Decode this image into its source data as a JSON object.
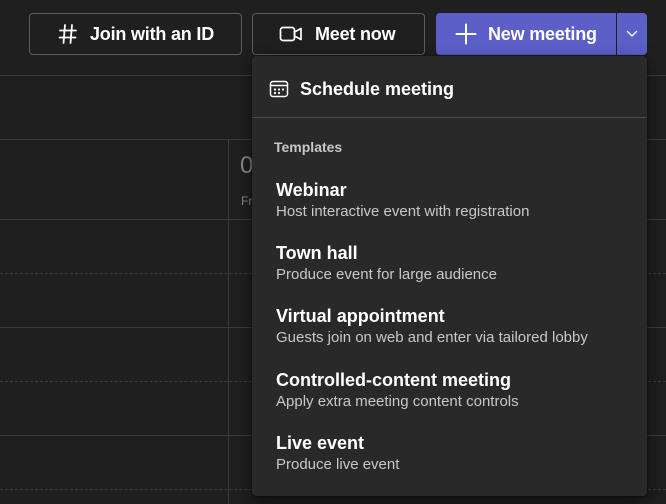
{
  "toolbar": {
    "join_label": "Join with an ID",
    "join_icon": "hash-icon",
    "meet_label": "Meet now",
    "meet_icon": "video-camera-icon",
    "new_label": "New meeting",
    "new_icon": "plus-icon",
    "split_icon": "chevron-down-icon",
    "accent_color": "#5b5fc7"
  },
  "calendar": {
    "day_number": "0",
    "day_name": "Fr"
  },
  "menu": {
    "schedule_label": "Schedule meeting",
    "schedule_icon": "calendar-icon",
    "section_label": "Templates",
    "templates": [
      {
        "title": "Webinar",
        "description": "Host interactive event with registration"
      },
      {
        "title": "Town hall",
        "description": "Produce event for large audience"
      },
      {
        "title": "Virtual appointment",
        "description": "Guests join on web and enter via tailored lobby"
      },
      {
        "title": "Controlled-content meeting",
        "description": "Apply extra meeting content controls"
      },
      {
        "title": "Live event",
        "description": "Produce live event"
      }
    ]
  }
}
